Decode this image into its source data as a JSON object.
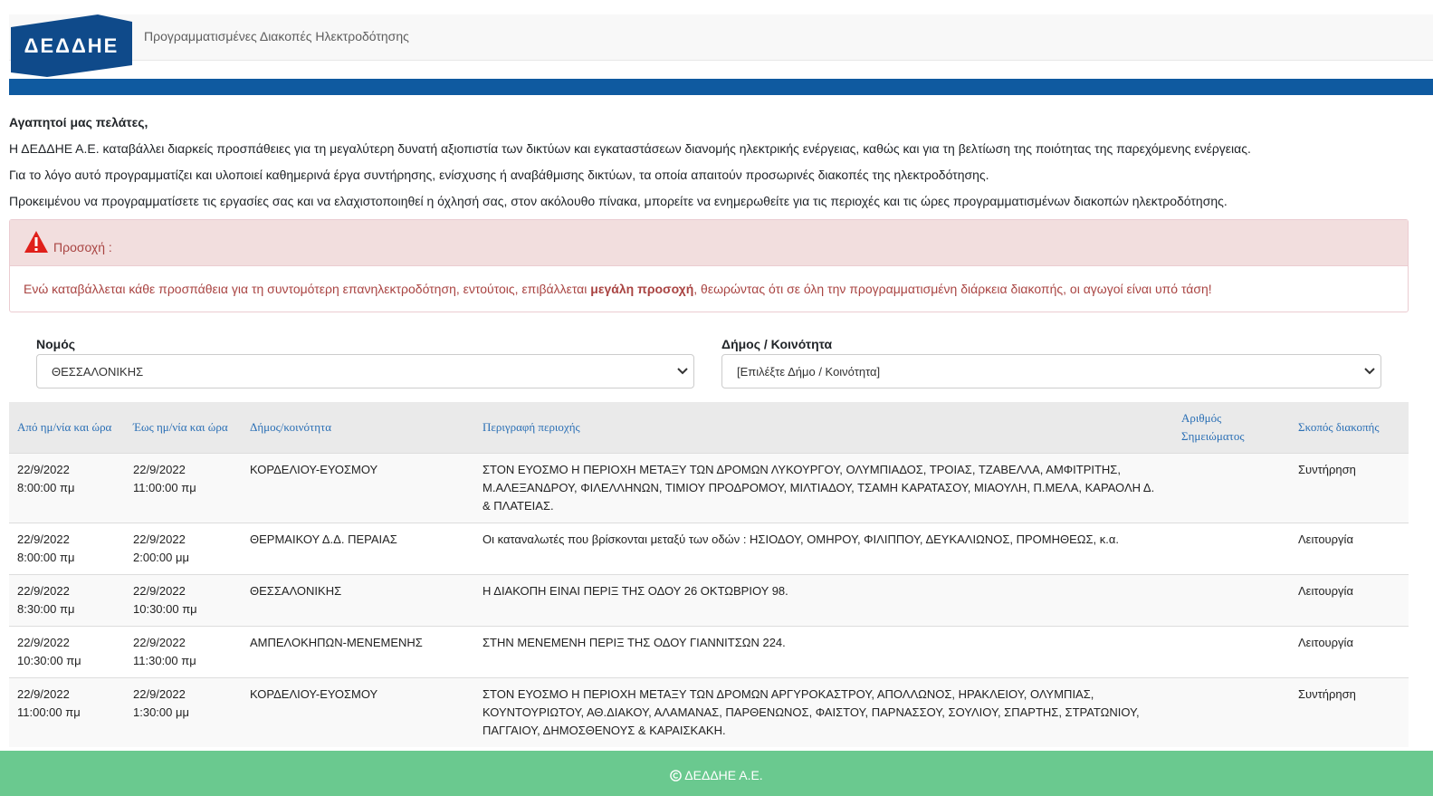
{
  "header": {
    "logo_text": "ΔΕΔΔΗΕ",
    "title": "Προγραμματισμένες Διακοπές Ηλεκτροδότησης"
  },
  "colors": {
    "brand_blue": "#0f5aa0",
    "alert_red": "#a94442",
    "footer_green": "#6ac98f"
  },
  "intro": {
    "greeting": "Αγαπητοί μας πελάτες,",
    "p1": "Η ΔΕΔΔΗΕ Α.Ε. καταβάλλει διαρκείς προσπάθειες για τη μεγαλύτερη δυνατή αξιοπιστία των δικτύων και εγκαταστάσεων διανομής ηλεκτρικής ενέργειας, καθώς και για τη βελτίωση της ποιότητας της παρεχόμενης ενέργειας.",
    "p2": "Για το λόγο αυτό προγραμματίζει και υλοποιεί καθημερινά έργα συντήρησης, ενίσχυσης ή αναβάθμισης δικτύων, τα οποία απαιτούν προσωρινές διακοπές της ηλεκτροδότησης.",
    "p3": "Προκειμένου να προγραμματίσετε τις εργασίες σας και να ελαχιστοποιηθεί η όχλησή σας, στον ακόλουθο πίνακα, μπορείτε να ενημερωθείτε για τις περιοχές και τις ώρες προγραμματισμένων διακοπών ηλεκτροδότησης."
  },
  "alert": {
    "heading": "Προσοχή :",
    "text_before": "Ενώ καταβάλλεται κάθε προσπάθεια για τη συντομότερη επανηλεκτροδότηση, εντούτοις, επιβάλλεται ",
    "text_bold": "μεγάλη προσοχή",
    "text_after": ", θεωρώντας ότι σε όλη την προγραμματισμένη διάρκεια διακοπής, οι αγωγοί είναι υπό τάση!"
  },
  "filters": {
    "prefecture_label": "Νομός",
    "prefecture_value": "ΘΕΣΣΑΛΟΝΙΚΗΣ",
    "municipality_label": "Δήμος / Κοινότητα",
    "municipality_value": "[Επιλέξτε Δήμο / Κοινότητα]"
  },
  "table": {
    "headers": [
      "Από ημ/νία και ώρα",
      "Έως ημ/νία και ώρα",
      "Δήμος/κοινότητα",
      "Περιγραφή περιοχής",
      "Αριθμός Σημειώματος",
      "Σκοπός διακοπής"
    ],
    "rows": [
      {
        "from_date": "22/9/2022",
        "from_time": "8:00:00 πμ",
        "to_date": "22/9/2022",
        "to_time": "11:00:00 πμ",
        "municipality": "ΚΟΡΔΕΛΙΟΥ-ΕΥΟΣΜΟΥ",
        "description": "ΣΤΟΝ ΕΥΟΣΜΟ Η ΠΕΡΙΟΧΗ ΜΕΤΑΞΥ ΤΩΝ ΔΡΟΜΩΝ ΛΥΚΟΥΡΓΟΥ, ΟΛΥΜΠΙΑΔΟΣ, ΤΡΟΙΑΣ, ΤΖΑΒΕΛΛΑ, ΑΜΦΙΤΡΙΤΗΣ, Μ.ΑΛΕΞΑΝΔΡΟΥ, ΦΙΛΕΛΛΗΝΩΝ, ΤΙΜΙΟΥ ΠΡΟΔΡΟΜΟΥ, ΜΙΛΤΙΑΔΟΥ, ΤΣΑΜΗ ΚΑΡΑΤΑΣΟΥ, ΜΙΑΟΥΛΗ, Π.ΜΕΛΑ, ΚΑΡΑΟΛΗ Δ. & ΠΛΑΤΕΙΑΣ.",
        "note": "",
        "purpose": "Συντήρηση"
      },
      {
        "from_date": "22/9/2022",
        "from_time": "8:00:00 πμ",
        "to_date": "22/9/2022",
        "to_time": "2:00:00 μμ",
        "municipality": "ΘΕΡΜΑΙΚΟΥ Δ.Δ. ΠΕΡΑΙΑΣ",
        "description": "Οι καταναλωτές που βρίσκονται μεταξύ των οδών : ΗΣΙΟΔΟΥ, ΟΜΗΡΟΥ, ΦΙΛΙΠΠΟΥ, ΔΕΥΚΑΛΙΩΝΟΣ, ΠΡΟΜΗΘΕΩΣ, κ.α.",
        "note": "",
        "purpose": "Λειτουργία"
      },
      {
        "from_date": "22/9/2022",
        "from_time": "8:30:00 πμ",
        "to_date": "22/9/2022",
        "to_time": "10:30:00 πμ",
        "municipality": "ΘΕΣΣΑΛΟΝΙΚΗΣ",
        "description": "Η ΔΙΑΚΟΠΗ ΕΙΝΑΙ ΠΕΡΙΞ ΤΗΣ ΟΔΟΥ 26 ΟΚΤΩΒΡΙΟΥ 98.",
        "note": "",
        "purpose": "Λειτουργία"
      },
      {
        "from_date": "22/9/2022",
        "from_time": "10:30:00 πμ",
        "to_date": "22/9/2022",
        "to_time": "11:30:00 πμ",
        "municipality": "ΑΜΠΕΛΟΚΗΠΩΝ-ΜΕΝΕΜΕΝΗΣ",
        "description": "ΣΤΗΝ ΜΕΝΕΜΕΝΗ ΠΕΡΙΞ ΤΗΣ ΟΔΟΥ ΓΙΑΝΝΙΤΣΩΝ 224.",
        "note": "",
        "purpose": "Λειτουργία"
      },
      {
        "from_date": "22/9/2022",
        "from_time": "11:00:00 πμ",
        "to_date": "22/9/2022",
        "to_time": "1:30:00 μμ",
        "municipality": "ΚΟΡΔΕΛΙΟΥ-ΕΥΟΣΜΟΥ",
        "description": "ΣΤΟΝ ΕΥΟΣΜΟ Η ΠΕΡΙΟΧΗ ΜΕΤΑΞΥ ΤΩΝ ΔΡΟΜΩΝ ΑΡΓΥΡΟΚΑΣΤΡΟΥ, ΑΠΟΛΛΩΝΟΣ, ΗΡΑΚΛΕΙΟΥ, ΟΛΥΜΠΙΑΣ, ΚΟΥΝΤΟΥΡΙΩΤΟΥ, ΑΘ.ΔΙΑΚΟΥ, ΑΛΑΜΑΝΑΣ, ΠΑΡΘΕΝΩΝΟΣ, ΦΑΙΣΤΟΥ, ΠΑΡΝΑΣΣΟΥ, ΣΟΥΛΙΟΥ, ΣΠΑΡΤΗΣ, ΣΤΡΑΤΩΝΙΟΥ, ΠΑΓΓΑΙΟΥ, ΔΗΜΟΣΘΕΝΟΥΣ & ΚΑΡΑΙΣΚΑΚΗ.",
        "note": "",
        "purpose": "Συντήρηση"
      }
    ]
  },
  "footer": {
    "text": "ΔΕΔΔΗΕ Α.Ε."
  }
}
